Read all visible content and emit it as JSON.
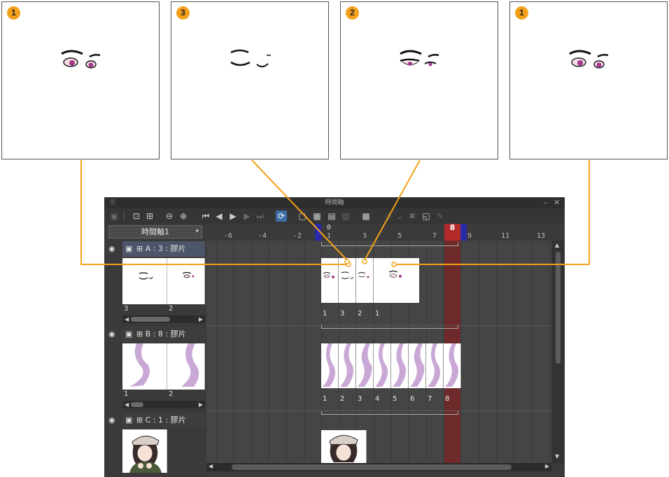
{
  "frames": [
    {
      "badge": "1"
    },
    {
      "badge": "3"
    },
    {
      "badge": "2"
    },
    {
      "badge": "1"
    }
  ],
  "window": {
    "title": "時間軸",
    "timeline_select": "時間軸1",
    "playhead_label": "8",
    "ruler_labels": [
      "-6",
      "-4",
      "-2",
      "0",
      "1",
      "3",
      "5",
      "7",
      "9",
      "11",
      "13"
    ],
    "tracks": [
      {
        "header": "A : 3 : 膠片",
        "thumb_numbers": [
          "3",
          "2"
        ],
        "cel_numbers": [
          "1",
          "3",
          "2",
          "1"
        ]
      },
      {
        "header": "B : 8 : 膠片",
        "thumb_numbers": [
          "1",
          "2"
        ],
        "cel_numbers": [
          "1",
          "2",
          "3",
          "4",
          "5",
          "6",
          "7",
          "8"
        ]
      },
      {
        "header": "C : 1 : 膠片",
        "thumb_numbers": [],
        "cel_numbers": []
      }
    ]
  },
  "colors": {
    "accent_orange": "#f4a01a",
    "playhead_red": "#b32a2a",
    "range_blue": "#2a2aa8"
  }
}
